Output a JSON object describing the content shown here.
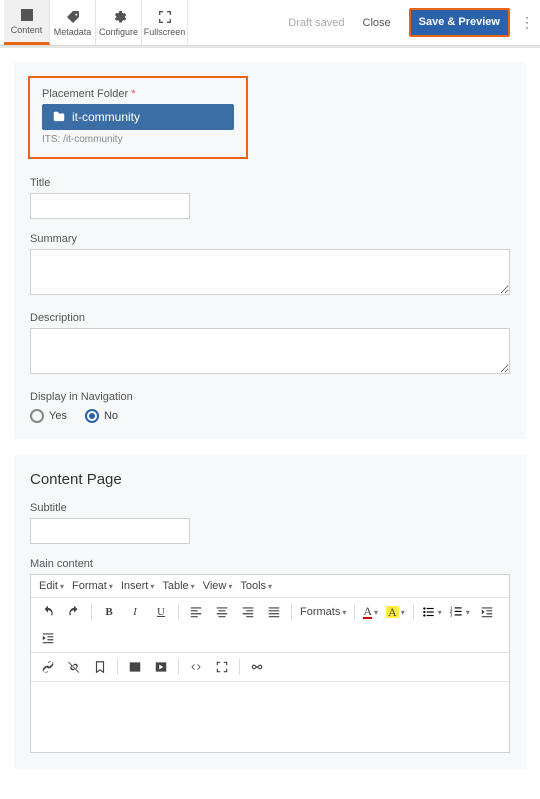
{
  "topbar": {
    "tabs": [
      {
        "label": "Content"
      },
      {
        "label": "Metadata"
      },
      {
        "label": "Configure"
      },
      {
        "label": "Fullscreen"
      }
    ],
    "draft_saved": "Draft saved",
    "close": "Close",
    "save_preview": "Save & Preview"
  },
  "placement": {
    "label": "Placement Folder",
    "required": "*",
    "folder_name": "it-community",
    "path": "ITS: /it-community"
  },
  "fields": {
    "title_label": "Title",
    "title_value": "",
    "summary_label": "Summary",
    "summary_value": "",
    "description_label": "Description",
    "description_value": "",
    "display_nav_label": "Display in Navigation",
    "yes": "Yes",
    "no": "No",
    "display_nav_selected": "No"
  },
  "content_page": {
    "heading": "Content Page",
    "subtitle_label": "Subtitle",
    "subtitle_value": "",
    "main_content_label": "Main content"
  },
  "rte": {
    "menus": [
      "Edit",
      "Format",
      "Insert",
      "Table",
      "View",
      "Tools"
    ],
    "formats_label": "Formats"
  }
}
